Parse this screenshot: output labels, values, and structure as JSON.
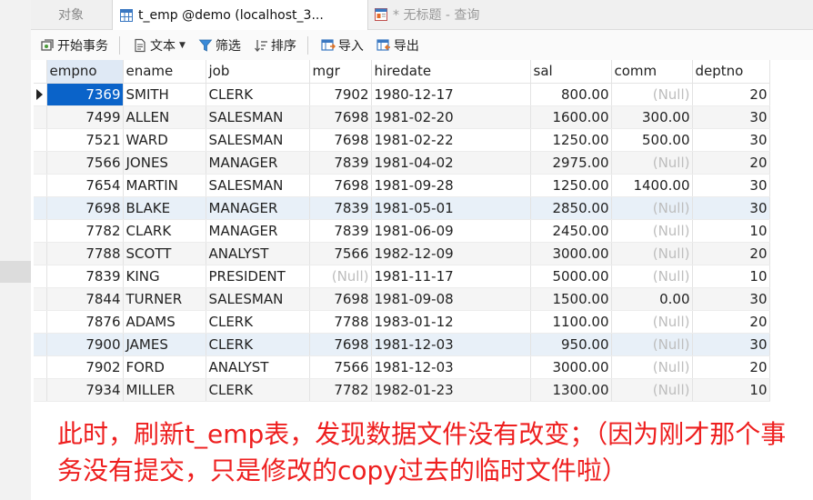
{
  "tabs": [
    {
      "label": "对象"
    },
    {
      "label": "t_emp @demo (localhost_3..."
    },
    {
      "label": "* 无标题 - 查询"
    }
  ],
  "toolbar": {
    "begin_transaction": "开始事务",
    "text": "文本",
    "filter": "筛选",
    "sort": "排序",
    "import": "导入",
    "export": "导出"
  },
  "grid": {
    "columns": [
      "empno",
      "ename",
      "job",
      "mgr",
      "hiredate",
      "sal",
      "comm",
      "deptno"
    ],
    "rows": [
      [
        "7369",
        "SMITH",
        "CLERK",
        "7902",
        "1980-12-17",
        "800.00",
        "(Null)",
        "20"
      ],
      [
        "7499",
        "ALLEN",
        "SALESMAN",
        "7698",
        "1981-02-20",
        "1600.00",
        "300.00",
        "30"
      ],
      [
        "7521",
        "WARD",
        "SALESMAN",
        "7698",
        "1981-02-22",
        "1250.00",
        "500.00",
        "30"
      ],
      [
        "7566",
        "JONES",
        "MANAGER",
        "7839",
        "1981-04-02",
        "2975.00",
        "(Null)",
        "20"
      ],
      [
        "7654",
        "MARTIN",
        "SALESMAN",
        "7698",
        "1981-09-28",
        "1250.00",
        "1400.00",
        "30"
      ],
      [
        "7698",
        "BLAKE",
        "MANAGER",
        "7839",
        "1981-05-01",
        "2850.00",
        "(Null)",
        "30"
      ],
      [
        "7782",
        "CLARK",
        "MANAGER",
        "7839",
        "1981-06-09",
        "2450.00",
        "(Null)",
        "10"
      ],
      [
        "7788",
        "SCOTT",
        "ANALYST",
        "7566",
        "1982-12-09",
        "3000.00",
        "(Null)",
        "20"
      ],
      [
        "7839",
        "KING",
        "PRESIDENT",
        "(Null)",
        "1981-11-17",
        "5000.00",
        "(Null)",
        "10"
      ],
      [
        "7844",
        "TURNER",
        "SALESMAN",
        "7698",
        "1981-09-08",
        "1500.00",
        "0.00",
        "30"
      ],
      [
        "7876",
        "ADAMS",
        "CLERK",
        "7788",
        "1983-01-12",
        "1100.00",
        "(Null)",
        "20"
      ],
      [
        "7900",
        "JAMES",
        "CLERK",
        "7698",
        "1981-12-03",
        "950.00",
        "(Null)",
        "30"
      ],
      [
        "7902",
        "FORD",
        "ANALYST",
        "7566",
        "1981-12-03",
        "3000.00",
        "(Null)",
        "20"
      ],
      [
        "7934",
        "MILLER",
        "CLERK",
        "7782",
        "1982-01-23",
        "1300.00",
        "(Null)",
        "10"
      ]
    ]
  },
  "annotation": "此时，刷新t_emp表，发现数据文件没有改变；（因为刚才那个事务没有提交，只是修改的copy过去的临时文件啦）",
  "colors": {
    "selected_cell": "#0a63c9",
    "annotation_text": "#ee1f1f",
    "null_text": "#bdbdbd"
  }
}
